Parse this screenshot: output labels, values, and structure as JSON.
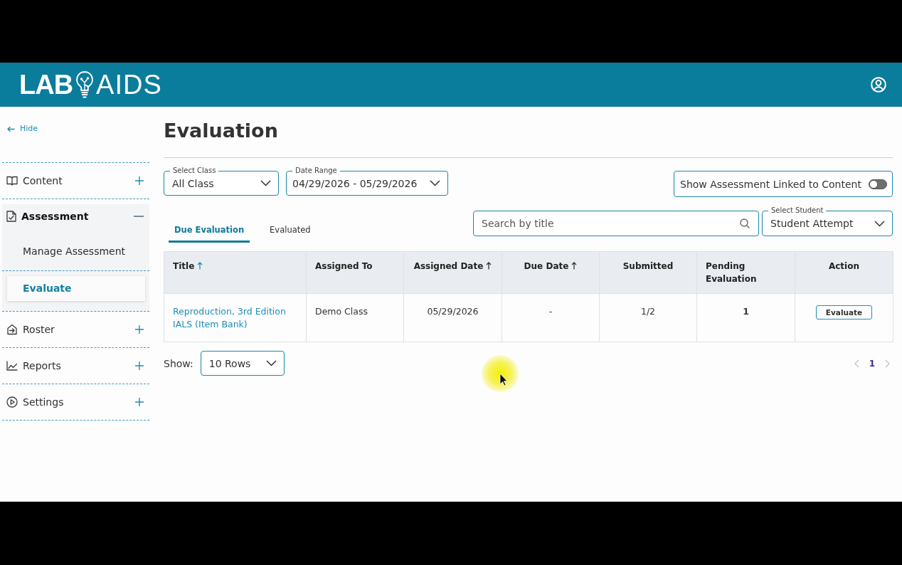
{
  "header": {
    "logo": [
      "LAB",
      "AIDS"
    ]
  },
  "sidebar": {
    "hide_link": "Hide",
    "items": [
      {
        "label": "Content",
        "expanded": false
      },
      {
        "label": "Assessment",
        "expanded": true,
        "children": [
          {
            "label": "Manage Assessment",
            "selected": false
          },
          {
            "label": "Evaluate",
            "selected": true
          }
        ]
      },
      {
        "label": "Roster",
        "expanded": false
      },
      {
        "label": "Reports",
        "expanded": false
      },
      {
        "label": "Settings",
        "expanded": false
      }
    ]
  },
  "page": {
    "title": "Evaluation"
  },
  "filters": [
    {
      "label": "Select Class",
      "value": "All Class"
    },
    {
      "label": "Date Range",
      "value": "04/29/2026 - 05/29/2026"
    }
  ],
  "linked_toggle": {
    "label": "Show Assessment Linked to Content",
    "on": false
  },
  "tabs": [
    {
      "label": "Due Evaluation",
      "selected": true
    },
    {
      "label": "Evaluated",
      "selected": false
    }
  ],
  "search": {
    "placeholder": "Search by title"
  },
  "student_select": {
    "label": "Select Student",
    "value": "Student Attempt"
  },
  "table": {
    "columns": [
      {
        "label": "Title",
        "sortable": true,
        "sorted": true
      },
      {
        "label": "Assigned To",
        "sortable": false,
        "sorted": false
      },
      {
        "label": "Assigned Date",
        "sortable": true,
        "sorted": false
      },
      {
        "label": "Due Date",
        "sortable": true,
        "sorted": false
      },
      {
        "label": "Submitted",
        "sortable": false,
        "sorted": false
      },
      {
        "label": "Pending Evaluation",
        "sortable": false,
        "sorted": false
      },
      {
        "label": "Action",
        "sortable": false,
        "sorted": false
      }
    ],
    "rows": [
      {
        "cells": [
          "Reproduction, 3rd Edition IALS (Item Bank)",
          "Demo Class",
          "05/29/2026",
          "-",
          "1/2",
          "1"
        ],
        "action": "Evaluate"
      }
    ]
  },
  "pager": {
    "show_label": "Show:",
    "rows_value": "10 Rows",
    "pages": [
      {
        "label": "1",
        "selected": true
      }
    ]
  }
}
